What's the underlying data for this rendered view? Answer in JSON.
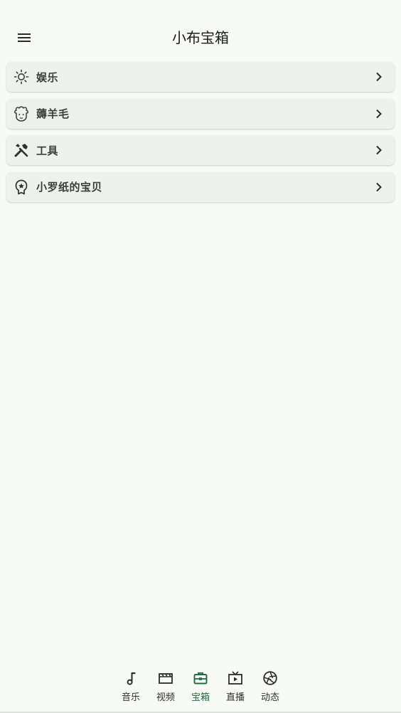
{
  "app": {
    "title": "小布宝箱",
    "accent": "#1e6b3f",
    "background": "#f8fbf5"
  },
  "header": {
    "menu_icon": "menu-icon"
  },
  "list": {
    "items": [
      {
        "label": "娱乐",
        "icon": "sun-icon"
      },
      {
        "label": "薅羊毛",
        "icon": "sheep-icon"
      },
      {
        "label": "工具",
        "icon": "tools-icon"
      },
      {
        "label": "小罗纸的宝贝",
        "icon": "award-icon"
      }
    ]
  },
  "bottom_nav": {
    "items": [
      {
        "label": "音乐",
        "icon": "music-note-icon",
        "active": false
      },
      {
        "label": "视频",
        "icon": "clapperboard-icon",
        "active": false
      },
      {
        "label": "宝箱",
        "icon": "toolbox-icon",
        "active": true
      },
      {
        "label": "直播",
        "icon": "tv-icon",
        "active": false
      },
      {
        "label": "动态",
        "icon": "aperture-icon",
        "active": false
      }
    ]
  }
}
